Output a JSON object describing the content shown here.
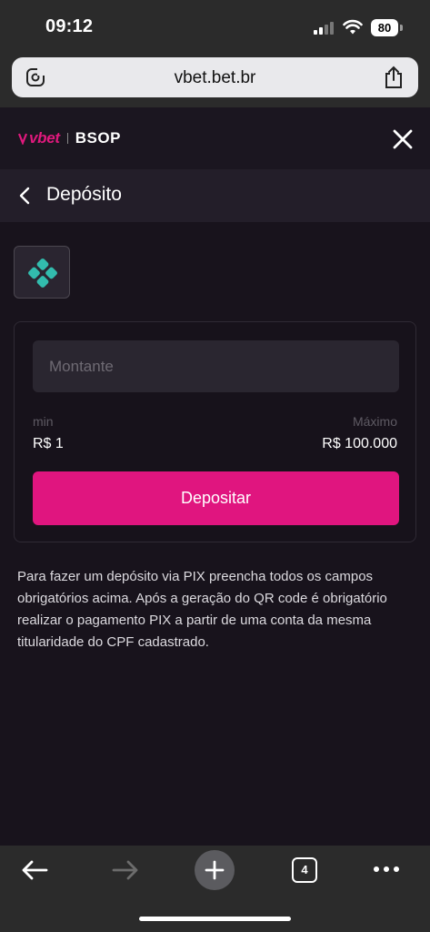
{
  "status_bar": {
    "time": "09:12",
    "battery": "80"
  },
  "browser": {
    "url": "vbet.bet.br",
    "open_tabs": "4"
  },
  "site_header": {
    "logo_vbet": "vbet",
    "logo_partner": "BSOP"
  },
  "page": {
    "title": "Depósito"
  },
  "deposit_form": {
    "amount_placeholder": "Montante",
    "min_label": "min",
    "min_value": "R$ 1",
    "max_label": "Máximo",
    "max_value": "R$ 100.000",
    "submit_label": "Depositar"
  },
  "info": {
    "text": "Para fazer um depósito via PIX preencha todos os campos obrigatórios acima. Após a geração do QR code é obrigatório realizar o pagamento PIX a partir de uma conta da mesma titularidade do CPF cadastrado."
  },
  "icons": {
    "payment_method": "pix-icon",
    "close": "close-icon",
    "back": "chevron-left-icon",
    "share": "share-icon",
    "page_menu": "page-settings-icon"
  },
  "colors": {
    "accent": "#e0157f",
    "pix": "#32bcad",
    "background": "#18131c"
  }
}
